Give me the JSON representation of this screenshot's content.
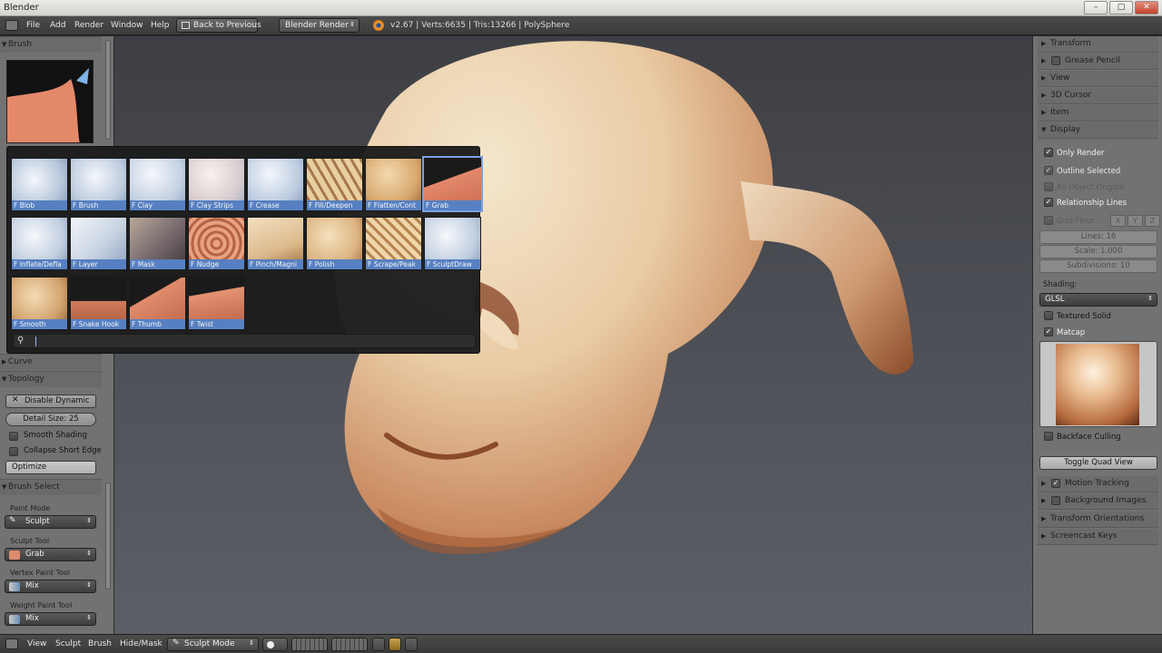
{
  "window": {
    "title": "Blender",
    "buttons": [
      "–",
      "□",
      "✕"
    ]
  },
  "header": {
    "menus": [
      "File",
      "Add",
      "Render",
      "Window",
      "Help"
    ],
    "back_button": "Back to Previous",
    "engine": "Blender Render",
    "stats": "v2.67 | Verts:6635 | Tris:13266 | PolySphere"
  },
  "toolshelf": {
    "brush_panel": "Brush",
    "curve_panel": "Curve",
    "topology_panel": "Topology",
    "disable_dynamic": "Disable Dynamic",
    "detail_size": "Detail Size: 25",
    "smooth_shading": "Smooth Shading",
    "collapse_short_edge": "Collapse Short Edge",
    "optimize": "Optimize",
    "brush_select_panel": "Brush Select",
    "paint_mode_label": "Paint Mode",
    "paint_mode_value": "Sculpt",
    "sculpt_tool_label": "Sculpt Tool",
    "sculpt_tool_value": "Grab",
    "vertex_paint_label": "Vertex Paint Tool",
    "vertex_paint_value": "Mix",
    "weight_paint_label": "Weight Paint Tool",
    "weight_paint_value": "Mix"
  },
  "brush_popup": {
    "brushes": [
      {
        "label": "F Blob",
        "active": false
      },
      {
        "label": "F Brush",
        "active": false
      },
      {
        "label": "F Clay",
        "active": false
      },
      {
        "label": "F Clay Strips",
        "active": false
      },
      {
        "label": "F Crease",
        "active": false
      },
      {
        "label": "F Fill/Deepen",
        "active": false
      },
      {
        "label": "F Flatten/Cont",
        "active": false
      },
      {
        "label": "F Grab",
        "active": true
      },
      {
        "label": "F Inflate/Defla",
        "active": false
      },
      {
        "label": "F Layer",
        "active": false
      },
      {
        "label": "F Mask",
        "active": false
      },
      {
        "label": "F Nudge",
        "active": false
      },
      {
        "label": "F Pinch/Magni",
        "active": false
      },
      {
        "label": "F Polish",
        "active": false
      },
      {
        "label": "F Scrape/Peak",
        "active": false
      },
      {
        "label": "F SculptDraw",
        "active": false
      },
      {
        "label": "F Smooth",
        "active": false
      },
      {
        "label": "F Snake Hook",
        "active": false
      },
      {
        "label": "F Thumb",
        "active": false
      },
      {
        "label": "F Twist",
        "active": false
      }
    ],
    "search_value": ""
  },
  "properties": {
    "transform": "Transform",
    "grease_pencil": "Grease Pencil",
    "view": "View",
    "cursor_3d": "3D Cursor",
    "item": "Item",
    "display": "Display",
    "only_render": "Only Render",
    "outline_selected": "Outline Selected",
    "all_object_origins": "All Object Origins",
    "relationship_lines": "Relationship Lines",
    "grid_floor": "Grid Floor",
    "axis_x": "X",
    "axis_y": "Y",
    "axis_z": "Z",
    "lines": "Lines: 16",
    "scale": "Scale: 1.000",
    "subdivisions": "Subdivisions: 10",
    "shading_label": "Shading:",
    "shading_value": "GLSL",
    "textured_solid": "Textured Solid",
    "matcap": "Matcap",
    "backface_culling": "Backface Culling",
    "toggle_quad_view": "Toggle Quad View",
    "motion_tracking": "Motion Tracking",
    "background_images": "Background Images",
    "transform_orientations": "Transform Orientations",
    "screencast_keys": "Screencast Keys"
  },
  "footer": {
    "menus": [
      "View",
      "Sculpt",
      "Brush",
      "Hide/Mask"
    ],
    "mode": "Sculpt Mode"
  },
  "colors": {
    "accent": "#5680c2",
    "skin": "#e8c9a0",
    "panel": "#727272"
  }
}
